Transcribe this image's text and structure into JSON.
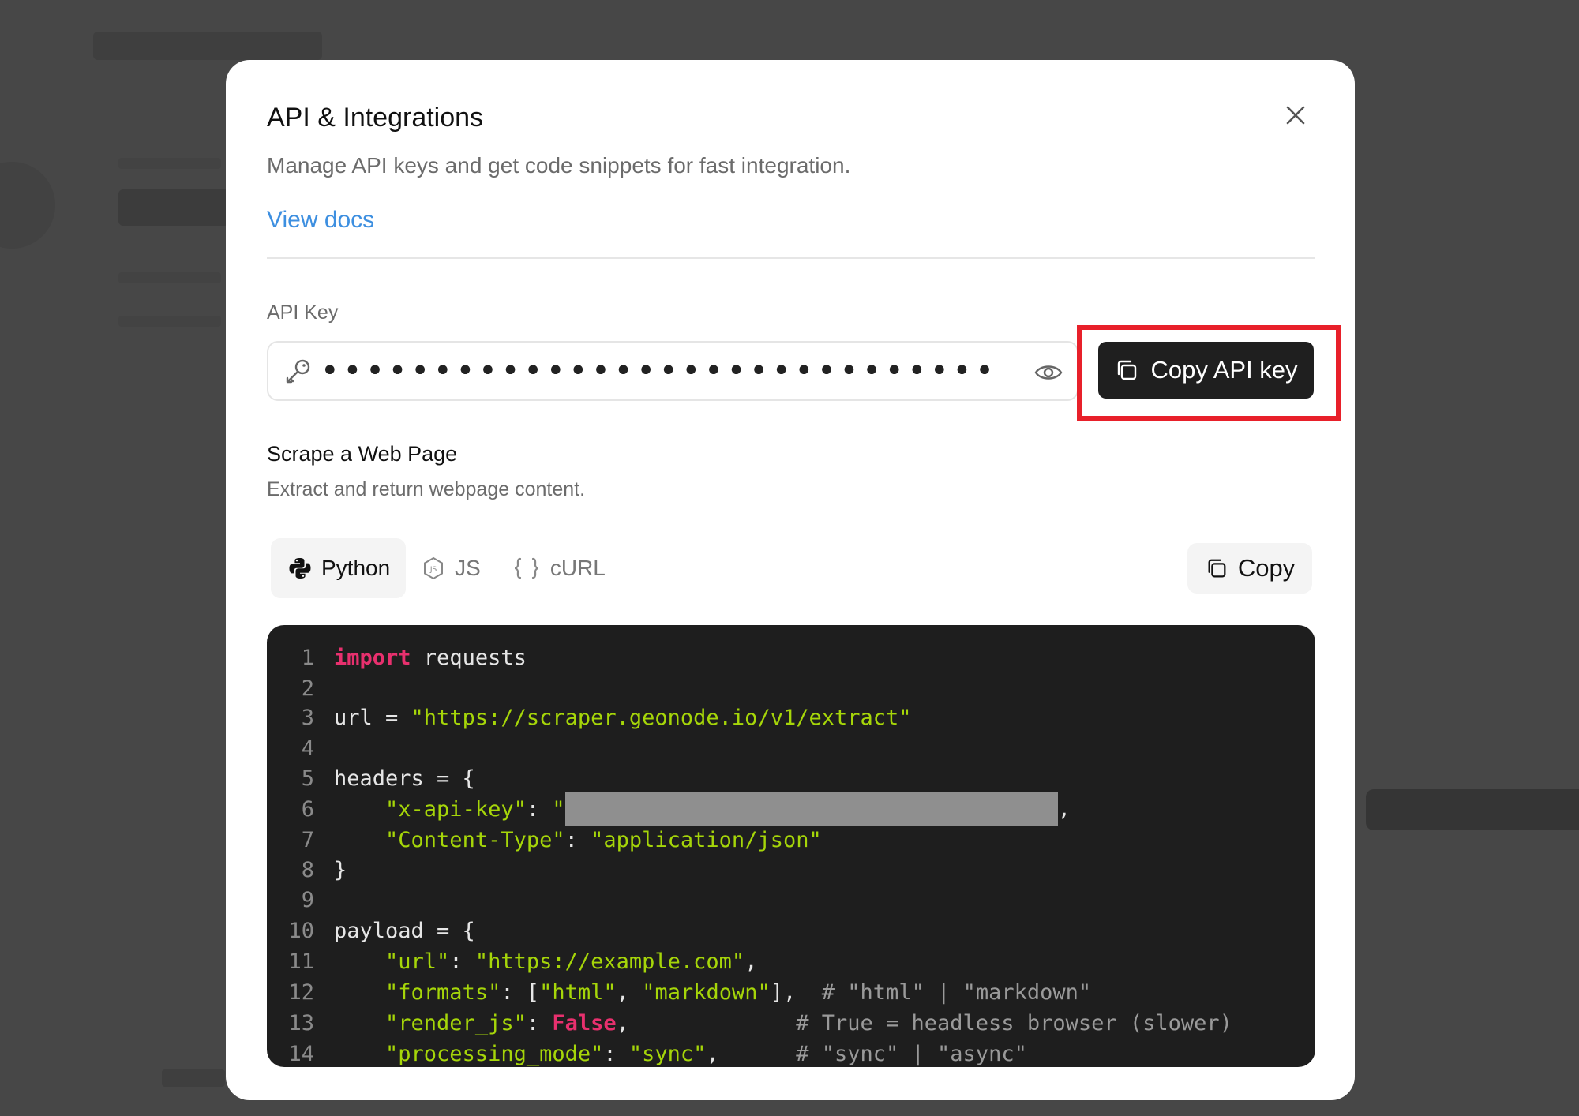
{
  "modal": {
    "title": "API & Integrations",
    "subtitle": "Manage API keys and get code snippets for fast integration.",
    "docs_link": "View docs",
    "api_key": {
      "label": "API Key",
      "masked_value": "••••••••••••••••••••••••••••••••",
      "copy_button": "Copy API key"
    },
    "section": {
      "title": "Scrape a Web Page",
      "description": "Extract and return webpage content."
    },
    "tabs": [
      {
        "label": "Python",
        "icon": "python-icon",
        "active": true
      },
      {
        "label": "JS",
        "icon": "js-icon",
        "active": false
      },
      {
        "label": "cURL",
        "icon": "braces-icon",
        "active": false
      }
    ],
    "copy_button": "Copy",
    "code": {
      "lines": [
        {
          "n": "1",
          "parts": [
            {
              "t": "kw",
              "v": "import"
            },
            {
              "t": "txt",
              "v": " requests"
            }
          ]
        },
        {
          "n": "2",
          "parts": []
        },
        {
          "n": "3",
          "parts": [
            {
              "t": "txt",
              "v": "url = "
            },
            {
              "t": "str",
              "v": "\"https://scraper.geonode.io/v1/extract\""
            }
          ]
        },
        {
          "n": "4",
          "parts": []
        },
        {
          "n": "5",
          "parts": [
            {
              "t": "txt",
              "v": "headers = {"
            }
          ]
        },
        {
          "n": "6",
          "parts": [
            {
              "t": "txt",
              "v": "    "
            },
            {
              "t": "str",
              "v": "\"x-api-key\""
            },
            {
              "t": "txt",
              "v": ": "
            },
            {
              "t": "str",
              "v": "\""
            },
            {
              "t": "redact",
              "v": ""
            },
            {
              "t": "txt",
              "v": ","
            }
          ]
        },
        {
          "n": "7",
          "parts": [
            {
              "t": "txt",
              "v": "    "
            },
            {
              "t": "str",
              "v": "\"Content-Type\""
            },
            {
              "t": "txt",
              "v": ": "
            },
            {
              "t": "str",
              "v": "\"application/json\""
            }
          ]
        },
        {
          "n": "8",
          "parts": [
            {
              "t": "txt",
              "v": "}"
            }
          ]
        },
        {
          "n": "9",
          "parts": []
        },
        {
          "n": "10",
          "parts": [
            {
              "t": "txt",
              "v": "payload = {"
            }
          ]
        },
        {
          "n": "11",
          "parts": [
            {
              "t": "txt",
              "v": "    "
            },
            {
              "t": "str",
              "v": "\"url\""
            },
            {
              "t": "txt",
              "v": ": "
            },
            {
              "t": "str",
              "v": "\"https://example.com\""
            },
            {
              "t": "txt",
              "v": ","
            }
          ]
        },
        {
          "n": "12",
          "parts": [
            {
              "t": "txt",
              "v": "    "
            },
            {
              "t": "str",
              "v": "\"formats\""
            },
            {
              "t": "txt",
              "v": ": ["
            },
            {
              "t": "str",
              "v": "\"html\""
            },
            {
              "t": "txt",
              "v": ", "
            },
            {
              "t": "str",
              "v": "\"markdown\""
            },
            {
              "t": "txt",
              "v": "],  "
            },
            {
              "t": "cm",
              "v": "# \"html\" | \"markdown\""
            }
          ]
        },
        {
          "n": "13",
          "parts": [
            {
              "t": "txt",
              "v": "    "
            },
            {
              "t": "str",
              "v": "\"render_js\""
            },
            {
              "t": "txt",
              "v": ": "
            },
            {
              "t": "kw",
              "v": "False"
            },
            {
              "t": "txt",
              "v": ",             "
            },
            {
              "t": "cm",
              "v": "# True = headless browser (slower)"
            }
          ]
        },
        {
          "n": "14",
          "parts": [
            {
              "t": "txt",
              "v": "    "
            },
            {
              "t": "str",
              "v": "\"processing_mode\""
            },
            {
              "t": "txt",
              "v": ": "
            },
            {
              "t": "str",
              "v": "\"sync\""
            },
            {
              "t": "txt",
              "v": ",      "
            },
            {
              "t": "cm",
              "v": "# \"sync\" | \"async\""
            }
          ]
        }
      ]
    }
  },
  "colors": {
    "accent_link": "#3d8fe0",
    "highlight": "#e8202a",
    "code_bg": "#1e1e1e",
    "keyword": "#e8306e",
    "string": "#a6d609"
  }
}
